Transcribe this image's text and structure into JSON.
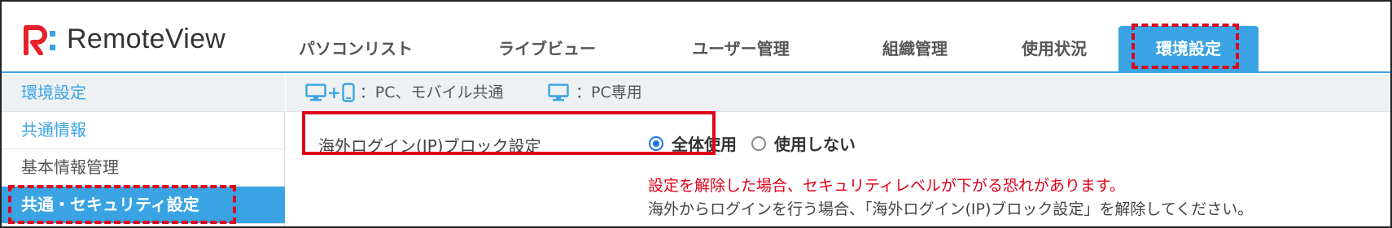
{
  "app": {
    "logo_text": "RemoteView"
  },
  "nav": {
    "tabs": [
      {
        "label": "パソコンリスト"
      },
      {
        "label": "ライブビュー"
      },
      {
        "label": "ユーザー管理"
      },
      {
        "label": "組織管理"
      },
      {
        "label": "使用状況"
      },
      {
        "label": "環境設定",
        "active": true
      }
    ]
  },
  "sidebar": {
    "title": "環境設定",
    "items": [
      {
        "label": "共通情報"
      },
      {
        "label": "基本情報管理"
      },
      {
        "label": "共通・セキュリティ設定",
        "active": true
      }
    ]
  },
  "legend": {
    "pc_mobile": "：PC、モバイル共通",
    "pc_only": "：PC専用"
  },
  "setting": {
    "label": "海外ログイン(IP)ブロック設定",
    "options": [
      {
        "label": "全体使用",
        "selected": true
      },
      {
        "label": "使用しない",
        "selected": false
      }
    ],
    "warning": "設定を解除した場合、セキュリティレベルが下がる恐れがあります。",
    "note": "海外からログインを行う場合、「海外ログイン(IP)ブロック設定」を解除してください。"
  },
  "colors": {
    "accent": "#3aa3e3",
    "highlight": "#e0001a",
    "logo_red": "#e8202a",
    "logo_blue": "#3aa3e3"
  }
}
